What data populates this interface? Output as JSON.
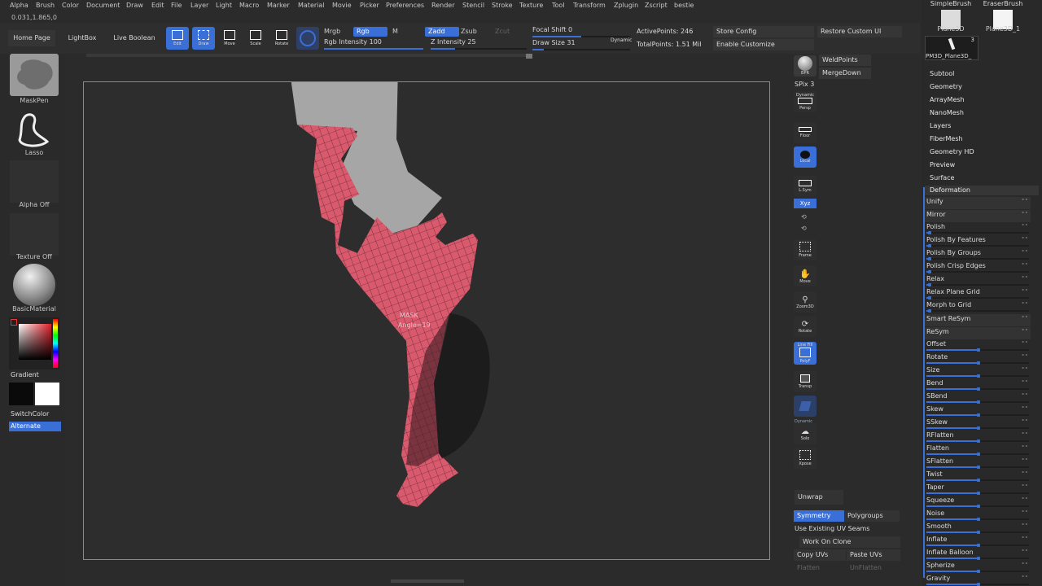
{
  "menu": [
    "Alpha",
    "Brush",
    "Color",
    "Document",
    "Draw",
    "Edit",
    "File",
    "Layer",
    "Light",
    "Macro",
    "Marker",
    "Material",
    "Movie",
    "Picker",
    "Preferences",
    "Render",
    "Stencil",
    "Stroke",
    "Texture",
    "Tool",
    "Transform",
    "Zplugin",
    "Zscript",
    "bestie"
  ],
  "coords": "0.031,1.865,0",
  "topbar": {
    "home_page": "Home Page",
    "lightbox": "LightBox",
    "live_boolean": "Live Boolean",
    "edit": "Edit",
    "draw": "Draw",
    "move": "Move",
    "scale": "Scale",
    "rotate": "Rotate",
    "mrgb": "Mrgb",
    "rgb": "Rgb",
    "m": "M",
    "rgb_intensity_label": "Rgb Intensity",
    "rgb_intensity_value": "100",
    "zadd": "Zadd",
    "zsub": "Zsub",
    "zcut": "Zcut",
    "z_intensity_label": "Z Intensity",
    "z_intensity_value": "25",
    "focal_shift_label": "Focal Shift",
    "focal_shift_value": "0",
    "draw_size_label": "Draw Size",
    "draw_size_value": "31",
    "dynamic": "Dynamic",
    "active_points": "ActivePoints: 246",
    "total_points": "TotalPoints: 1.51 Mil",
    "store_config": "Store Config",
    "enable_customize": "Enable Customize",
    "restore_custom_ui": "Restore Custom UI"
  },
  "left_panel": {
    "mask_pen": "MaskPen",
    "lasso": "Lasso",
    "alpha_off": "Alpha Off",
    "texture_off": "Texture Off",
    "basic_material": "BasicMaterial",
    "gradient": "Gradient",
    "switch_color": "SwitchColor",
    "alternate": "Alternate"
  },
  "canvas": {
    "mask_label": "MASK",
    "angle_label": "Angle=19"
  },
  "right_shelf": {
    "bpr": "BPR",
    "spix_label": "SPix 3",
    "dynamic": "Dynamic",
    "persp": "Persp",
    "floor": "Floor",
    "local": "Local",
    "lsym": "L.Sym",
    "xyz": "Xyz",
    "frame": "Frame",
    "move": "Move",
    "zoom3d": "Zoom3D",
    "rotate": "Rotate",
    "line_fill": "Line Fill",
    "polyf": "PolyF",
    "transp": "Transp",
    "ghost_dynamic": "Dynamic",
    "solo": "Solo",
    "xpose": "Xpose",
    "weld_points": "WeldPoints",
    "merge_down": "MergeDown"
  },
  "uv": {
    "unwrap": "Unwrap",
    "symmetry": "Symmetry",
    "polygroups": "Polygroups",
    "use_existing_uv_seams": "Use Existing UV Seams",
    "work_on_clone": "Work On Clone",
    "copy_uvs": "Copy UVs",
    "paste_uvs": "Paste UVs",
    "flatten": "Flatten",
    "unflatten": "UnFlatten"
  },
  "tool_panel": {
    "thumbs": [
      {
        "label": "SimpleBrush"
      },
      {
        "label": "EraserBrush"
      },
      {
        "label": "Plane3D"
      },
      {
        "label": "Plane3D_1"
      },
      {
        "label": "PM3D_Plane3D_"
      }
    ],
    "subtool_count": "3",
    "menu": [
      "Subtool",
      "Geometry",
      "ArrayMesh",
      "NanoMesh",
      "Layers",
      "FiberMesh",
      "Geometry HD",
      "Preview",
      "Surface"
    ],
    "deformation_title": "Deformation",
    "deformation_items": [
      {
        "label": "Unify",
        "slider": false
      },
      {
        "label": "Mirror",
        "slider": false
      },
      {
        "label": "Polish",
        "slider": true,
        "value": 0.02
      },
      {
        "label": "Polish By Features",
        "slider": true,
        "value": 0.02
      },
      {
        "label": "Polish By Groups",
        "slider": true,
        "value": 0.02
      },
      {
        "label": "Polish Crisp Edges",
        "slider": true,
        "value": 0.02
      },
      {
        "label": "Relax",
        "slider": true,
        "value": 0.02
      },
      {
        "label": "Relax Plane Grid",
        "slider": true,
        "value": 0.02
      },
      {
        "label": "Morph to Grid",
        "slider": true,
        "value": 0.02
      },
      {
        "label": "Smart ReSym",
        "slider": false
      },
      {
        "label": "ReSym",
        "slider": false
      },
      {
        "label": "Offset",
        "slider": true,
        "value": 0.5
      },
      {
        "label": "Rotate",
        "slider": true,
        "value": 0.5
      },
      {
        "label": "Size",
        "slider": true,
        "value": 0.5
      },
      {
        "label": "Bend",
        "slider": true,
        "value": 0.5
      },
      {
        "label": "SBend",
        "slider": true,
        "value": 0.5
      },
      {
        "label": "Skew",
        "slider": true,
        "value": 0.5
      },
      {
        "label": "SSkew",
        "slider": true,
        "value": 0.5
      },
      {
        "label": "RFlatten",
        "slider": true,
        "value": 0.5
      },
      {
        "label": "Flatten",
        "slider": true,
        "value": 0.5
      },
      {
        "label": "SFlatten",
        "slider": true,
        "value": 0.5
      },
      {
        "label": "Twist",
        "slider": true,
        "value": 0.5
      },
      {
        "label": "Taper",
        "slider": true,
        "value": 0.5
      },
      {
        "label": "Squeeze",
        "slider": true,
        "value": 0.5
      },
      {
        "label": "Noise",
        "slider": true,
        "value": 0.5
      },
      {
        "label": "Smooth",
        "slider": true,
        "value": 0.5
      },
      {
        "label": "Inflate",
        "slider": true,
        "value": 0.5
      },
      {
        "label": "Inflate Balloon",
        "slider": true,
        "value": 0.5
      },
      {
        "label": "Spherize",
        "slider": true,
        "value": 0.5
      },
      {
        "label": "Gravity",
        "slider": true,
        "value": 0.5
      }
    ]
  },
  "colors": {
    "accent": "#3a6fd8",
    "mask": "#d9596d",
    "mesh_gray": "#a6a6a6"
  }
}
